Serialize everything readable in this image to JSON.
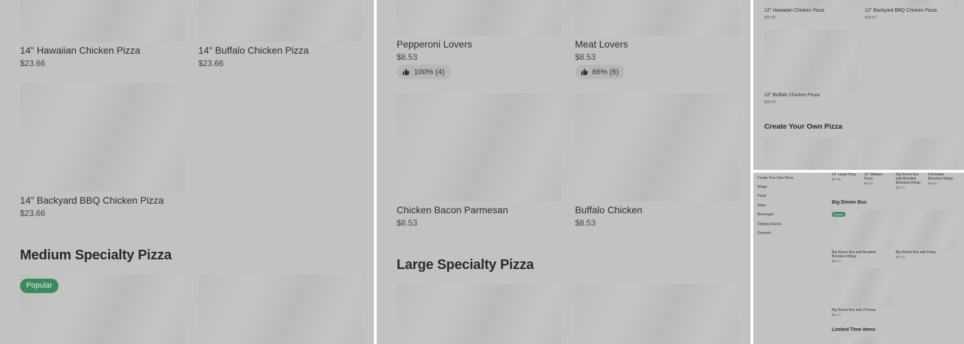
{
  "panel1": {
    "items": [
      {
        "name": "14\" Hawaiian Chicken Pizza",
        "price": "$23.66"
      },
      {
        "name": "14\" Buffalo Chicken Pizza",
        "price": "$23.66"
      },
      {
        "name": "14\" Backyard BBQ Chicken Pizza",
        "price": "$23.66"
      }
    ],
    "section_title": "Medium Specialty Pizza",
    "popular_badge": "Popular"
  },
  "panel2": {
    "items": [
      {
        "name": "Pepperoni Lovers",
        "price": "$8.53",
        "rating": "100% (4)"
      },
      {
        "name": "Meat Lovers",
        "price": "$8.53",
        "rating": "66% (6)"
      },
      {
        "name": "Chicken Bacon Parmesan",
        "price": "$8.53"
      },
      {
        "name": "Buffalo Chicken",
        "price": "$8.53"
      }
    ],
    "section_title": "Large Specialty Pizza"
  },
  "panel3": {
    "items": [
      {
        "name": "12\" Hawaiian Chicken Pizza",
        "price": "$20.97"
      },
      {
        "name": "12\" Backyard BBQ Chicken Pizza",
        "price": "$20.97"
      },
      {
        "name": "12\" Buffalo Chicken Pizza",
        "price": "$20.97"
      }
    ],
    "section_title": "Create Your Own Pizza"
  },
  "panel4": {
    "nav": [
      "Create Your Own Pizza",
      "Wings",
      "Pasta",
      "Sides",
      "Beverages",
      "Dipping Sauces",
      "Desserts"
    ],
    "top_items": [
      {
        "name": "14\" Large Pizza",
        "price": "$27.98"
      },
      {
        "name": "12\" Medium Pizza",
        "price": "$24.97"
      },
      {
        "name": "Big Dinner Box with Breaded Boneless Wings",
        "price": "$31.73"
      },
      {
        "name": "8 Breaded Boneless Wings",
        "price": "$10.97"
      }
    ],
    "section_title": "Big Dinner Box",
    "popular_badge": "Popular",
    "items": [
      {
        "name": "Big Dinner Box with Breaded Boneless Wings",
        "price": "$31.73"
      },
      {
        "name": "Big Dinner Box with Pasta",
        "price": "$31.73"
      },
      {
        "name": "Big Dinner Box with 3 Pizzas",
        "price": "$31.73"
      }
    ],
    "section2_title": "Limited Time Items"
  },
  "colors": {
    "overlay": "#c2c2c2",
    "popular": "#3c8a5c",
    "rating_bg": "#b6b6b6"
  }
}
